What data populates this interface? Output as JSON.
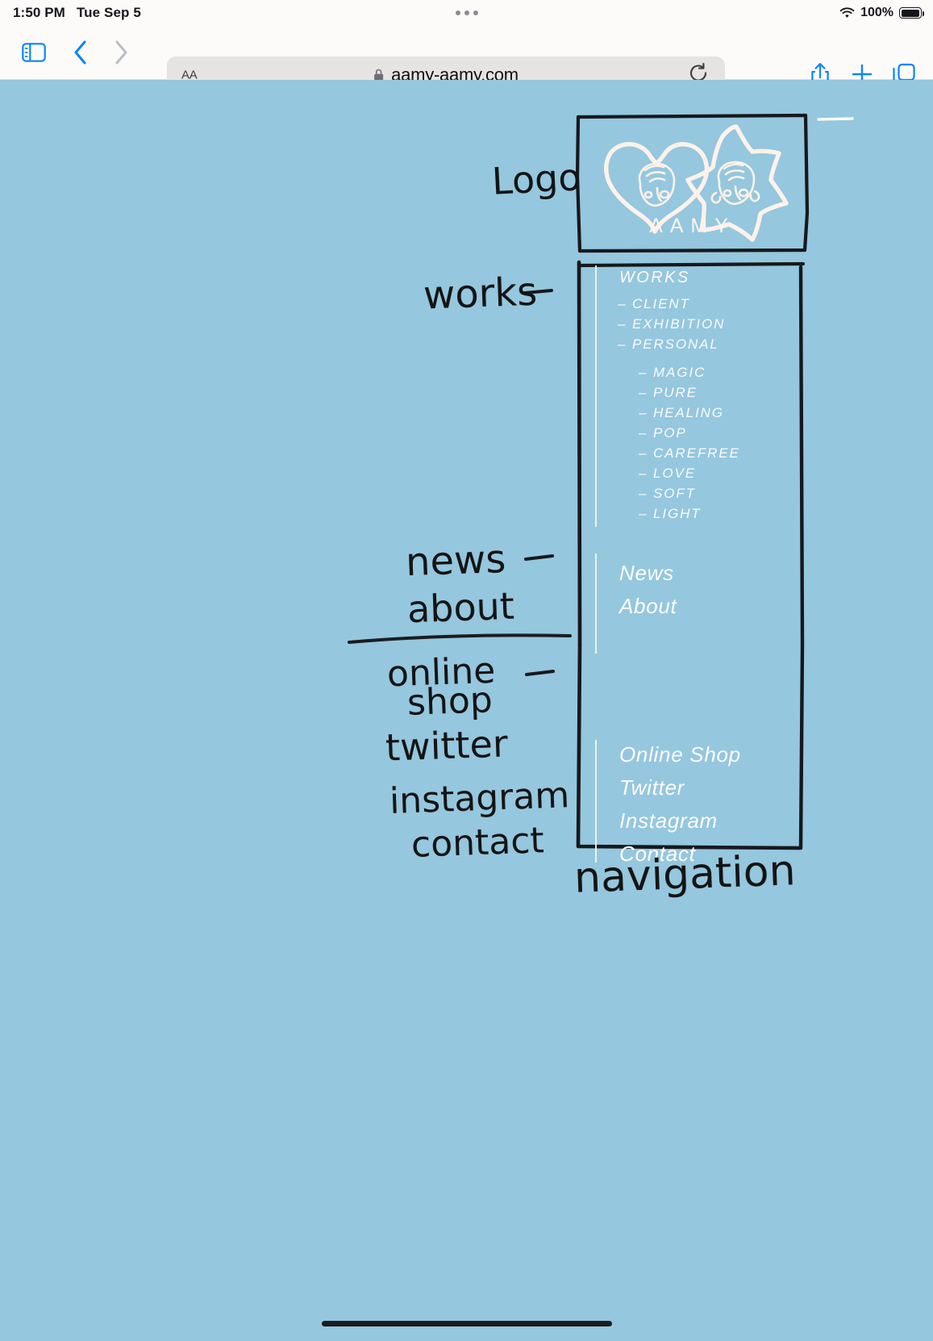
{
  "status_bar": {
    "time": "1:50 PM",
    "date": "Tue Sep 5",
    "battery_percent": "100%",
    "wifi_icon": "wifi-icon",
    "battery_icon": "battery-full-icon",
    "more_icon": "three-dots-icon"
  },
  "toolbar": {
    "sidebar_icon": "sidebar-toggle-icon",
    "back_icon": "chevron-left-icon",
    "forward_icon": "chevron-right-icon",
    "text_size_label": "AA",
    "lock_icon": "lock-icon",
    "url": "aamy-aamy.com",
    "reload_icon": "reload-icon",
    "share_icon": "share-icon",
    "new_tab_icon": "plus-icon",
    "tabs_icon": "tab-overview-icon"
  },
  "colors": {
    "page_background": "#95C7DE",
    "ink": "#141414",
    "menu_text": "#FFFFFF",
    "logo_stroke": "#FDF2E9",
    "chrome_background": "#FDFBF9",
    "url_field": "#E6E4E2",
    "accent_blue": "#0A84FF"
  },
  "site": {
    "logo": {
      "wordmark": "AAMY",
      "heart_icon": "heart-face-icon",
      "star_icon": "star-face-icon"
    },
    "navigation": {
      "works": {
        "heading": "WORKS",
        "categories": [
          {
            "label": "CLIENT",
            "marker": "–"
          },
          {
            "label": "EXHIBITION",
            "marker": "–"
          },
          {
            "label": "PERSONAL",
            "marker": "–"
          }
        ],
        "personal_sub": [
          {
            "label": "MAGIC",
            "marker": "–"
          },
          {
            "label": "PURE",
            "marker": "–"
          },
          {
            "label": "HEALING",
            "marker": "–"
          },
          {
            "label": "POP",
            "marker": "–"
          },
          {
            "label": "CAREFREE",
            "marker": "–"
          },
          {
            "label": "LOVE",
            "marker": "–"
          },
          {
            "label": "SOFT",
            "marker": "–"
          },
          {
            "label": "LIGHT",
            "marker": "–"
          }
        ]
      },
      "pages": [
        {
          "label": "News"
        },
        {
          "label": "About"
        }
      ],
      "links": [
        {
          "label": "Online Shop"
        },
        {
          "label": "Twitter"
        },
        {
          "label": "Instagram"
        },
        {
          "label": "Contact"
        }
      ]
    }
  },
  "annotations": [
    {
      "id": "logo",
      "text": "Logo"
    },
    {
      "id": "works",
      "text": "works"
    },
    {
      "id": "news",
      "text": "news"
    },
    {
      "id": "about",
      "text": "about"
    },
    {
      "id": "online-shop",
      "text": "online"
    },
    {
      "id": "shop",
      "text": "shop"
    },
    {
      "id": "twitter",
      "text": "twitter"
    },
    {
      "id": "instagram",
      "text": "instagram"
    },
    {
      "id": "contact",
      "text": "contact"
    },
    {
      "id": "navigation",
      "text": "navigation"
    }
  ],
  "home_indicator": "home-indicator"
}
